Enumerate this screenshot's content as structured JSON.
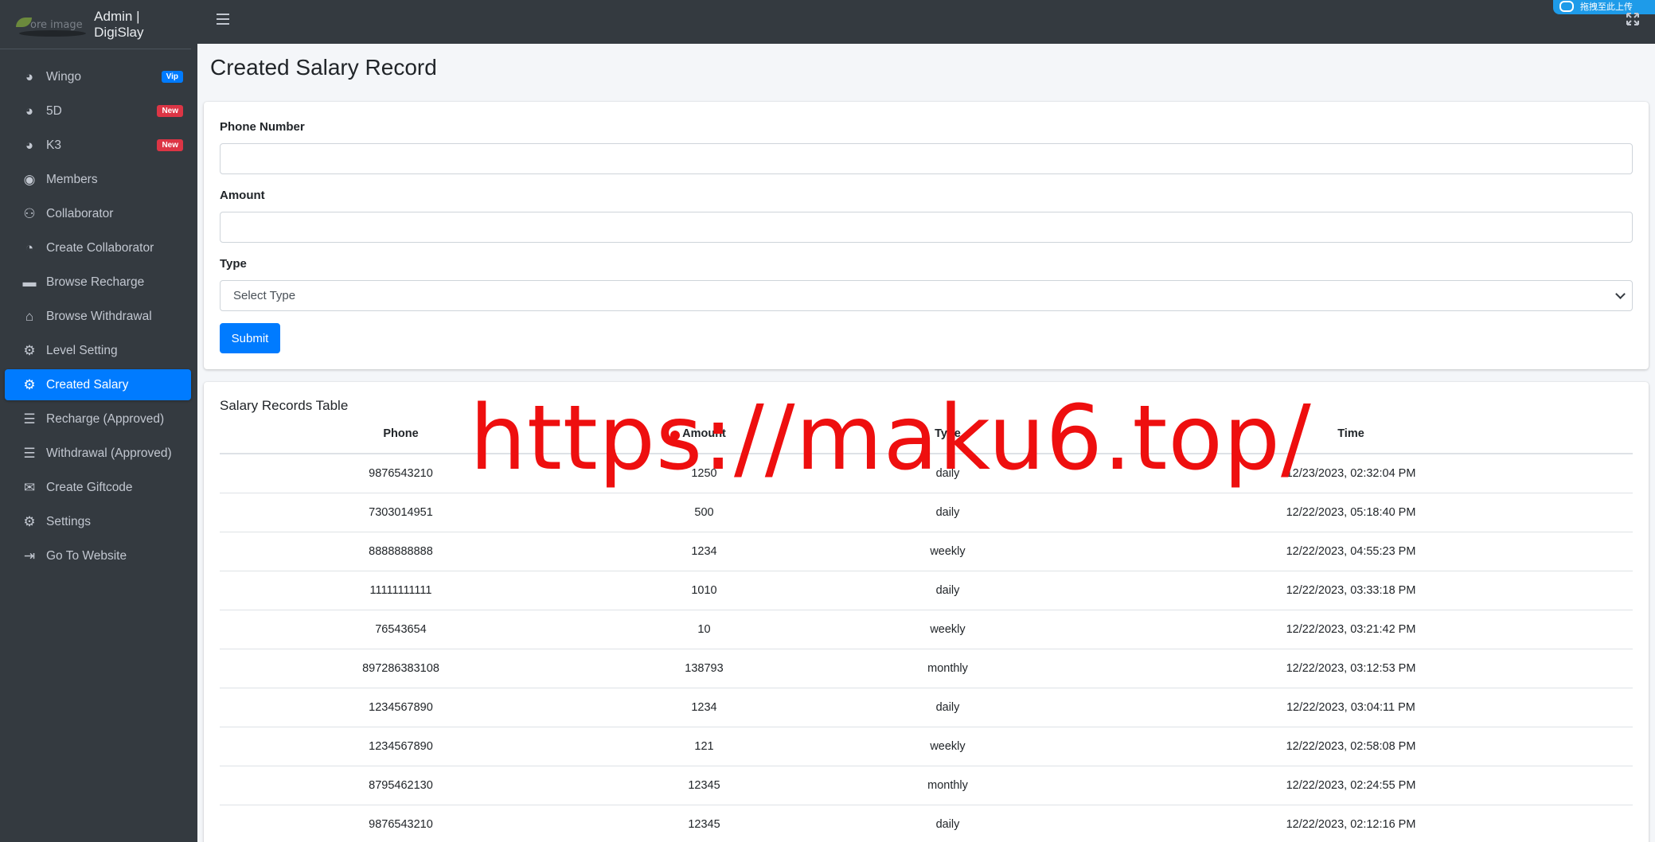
{
  "brand": {
    "logo_alt": "ore image",
    "title": "Admin | DigiSlay"
  },
  "sidebar": {
    "items": [
      {
        "label": "Wingo",
        "icon": "palette-icon",
        "badge": "Vip",
        "badge_color": "#007bff"
      },
      {
        "label": "5D",
        "icon": "palette-icon",
        "badge": "New",
        "badge_color": "#dc3545"
      },
      {
        "label": "K3",
        "icon": "palette-icon",
        "badge": "New",
        "badge_color": "#dc3545"
      },
      {
        "label": "Members",
        "icon": "user-circle-icon"
      },
      {
        "label": "Collaborator",
        "icon": "users-icon"
      },
      {
        "label": "Create Collaborator",
        "icon": "pie-chart-icon"
      },
      {
        "label": "Browse Recharge",
        "icon": "credit-card-icon"
      },
      {
        "label": "Browse Withdrawal",
        "icon": "bank-icon"
      },
      {
        "label": "Level Setting",
        "icon": "cogs-icon"
      },
      {
        "label": "Created Salary",
        "icon": "cogs-icon",
        "active": true
      },
      {
        "label": "Recharge (Approved)",
        "icon": "list-icon"
      },
      {
        "label": "Withdrawal (Approved)",
        "icon": "list-icon"
      },
      {
        "label": "Create Giftcode",
        "icon": "gift-icon"
      },
      {
        "label": "Settings",
        "icon": "gear-icon"
      },
      {
        "label": "Go To Website",
        "icon": "sign-out-icon"
      }
    ]
  },
  "topbar": {
    "widget_text": "拖拽至此上传"
  },
  "page": {
    "title": "Created Salary Record"
  },
  "form": {
    "phone_label": "Phone Number",
    "phone_value": "",
    "amount_label": "Amount",
    "amount_value": "",
    "type_label": "Type",
    "type_selected": "Select Type",
    "submit_label": "Submit"
  },
  "table": {
    "title": "Salary Records Table",
    "headers": [
      "Phone",
      "Amount",
      "Type",
      "Time"
    ],
    "rows": [
      [
        "9876543210",
        "1250",
        "daily",
        "12/23/2023, 02:32:04 PM"
      ],
      [
        "7303014951",
        "500",
        "daily",
        "12/22/2023, 05:18:40 PM"
      ],
      [
        "8888888888",
        "1234",
        "weekly",
        "12/22/2023, 04:55:23 PM"
      ],
      [
        "11111111111",
        "1010",
        "daily",
        "12/22/2023, 03:33:18 PM"
      ],
      [
        "76543654",
        "10",
        "weekly",
        "12/22/2023, 03:21:42 PM"
      ],
      [
        "897286383108",
        "138793",
        "monthly",
        "12/22/2023, 03:12:53 PM"
      ],
      [
        "1234567890",
        "1234",
        "daily",
        "12/22/2023, 03:04:11 PM"
      ],
      [
        "1234567890",
        "121",
        "weekly",
        "12/22/2023, 02:58:08 PM"
      ],
      [
        "8795462130",
        "12345",
        "monthly",
        "12/22/2023, 02:24:55 PM"
      ],
      [
        "9876543210",
        "12345",
        "daily",
        "12/22/2023, 02:12:16 PM"
      ]
    ]
  },
  "watermark": {
    "text": "https://maku6.top/"
  },
  "colors": {
    "accent": "#007bff",
    "sidebar_bg": "#343a40",
    "watermark": "#ee0f0f"
  }
}
